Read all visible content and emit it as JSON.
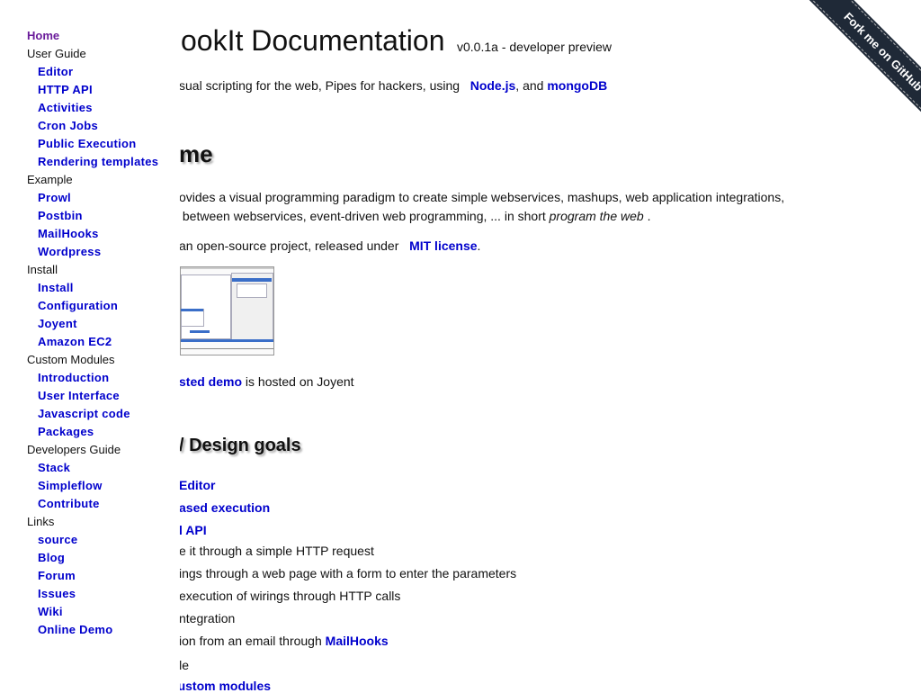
{
  "header": {
    "title": "ookIt Documentation",
    "version": "v0.0.1a - developer preview",
    "tagline_prefix": "sual scripting for the web, Pipes for hackers, using",
    "link_node": "Node.js",
    "tagline_mid": ", and",
    "link_mongo": "mongoDB"
  },
  "welcome": {
    "heading": "me",
    "p1_line1": "ovides a visual programming paradigm to create simple webservices, mashups, web application integrations,",
    "p1_line2_prefix": "between webservices, event-driven web programming, ... in short",
    "p1_italic": "program the web",
    "p1_end": ".",
    "p2_prefix": "an open-source project, released under",
    "p2_link": "MIT license",
    "p2_end": ".",
    "demo_link": "sted demo",
    "demo_suffix": "is hosted on Joyent"
  },
  "design": {
    "heading": "/ Design goals",
    "link_editor": "Editor",
    "link_exec": "ased execution",
    "link_api": "l API",
    "line_http": "e it through a simple HTTP request",
    "line_form": "ings through a web page with a form to enter the parameters",
    "line_calls": "execution of wirings through HTTP calls",
    "line_integration": "ntegration",
    "line_email_prefix": "ion from an email through",
    "link_mailhooks": "MailHooks",
    "extensible": "extensible",
    "link_custom": "add custom modules"
  },
  "sidebar": {
    "items": [
      {
        "label": "Home",
        "level": "top",
        "link": true
      },
      {
        "label": "User Guide",
        "level": "top",
        "link": false
      },
      {
        "label": "Editor",
        "level": "sub",
        "link": true
      },
      {
        "label": "HTTP API",
        "level": "sub",
        "link": true
      },
      {
        "label": "Activities",
        "level": "sub",
        "link": true
      },
      {
        "label": "Cron Jobs",
        "level": "sub",
        "link": true
      },
      {
        "label": "Public Execution",
        "level": "sub",
        "link": true
      },
      {
        "label": "Rendering templates",
        "level": "sub",
        "link": true
      },
      {
        "label": "Example",
        "level": "top",
        "link": false
      },
      {
        "label": "Prowl",
        "level": "sub",
        "link": true
      },
      {
        "label": "Postbin",
        "level": "sub",
        "link": true
      },
      {
        "label": "MailHooks",
        "level": "sub",
        "link": true
      },
      {
        "label": "Wordpress",
        "level": "sub",
        "link": true
      },
      {
        "label": "Install",
        "level": "top",
        "link": false
      },
      {
        "label": "Install",
        "level": "sub",
        "link": true
      },
      {
        "label": "Configuration",
        "level": "sub",
        "link": true
      },
      {
        "label": "Joyent",
        "level": "sub",
        "link": true
      },
      {
        "label": "Amazon EC2",
        "level": "sub",
        "link": true
      },
      {
        "label": "Custom Modules",
        "level": "top",
        "link": false
      },
      {
        "label": "Introduction",
        "level": "sub",
        "link": true
      },
      {
        "label": "User Interface",
        "level": "sub",
        "link": true
      },
      {
        "label": "Javascript code",
        "level": "sub",
        "link": true
      },
      {
        "label": "Packages",
        "level": "sub",
        "link": true
      },
      {
        "label": "Developers Guide",
        "level": "top",
        "link": false
      },
      {
        "label": "Stack",
        "level": "sub",
        "link": true
      },
      {
        "label": "Simpleflow",
        "level": "sub",
        "link": true
      },
      {
        "label": "Contribute",
        "level": "sub",
        "link": true
      },
      {
        "label": "Links",
        "level": "top",
        "link": false
      },
      {
        "label": "source",
        "level": "sub",
        "link": true
      },
      {
        "label": "Blog",
        "level": "sub",
        "link": true
      },
      {
        "label": "Forum",
        "level": "sub",
        "link": true
      },
      {
        "label": "Issues",
        "level": "sub",
        "link": true
      },
      {
        "label": "Wiki",
        "level": "sub",
        "link": true
      },
      {
        "label": "Online Demo",
        "level": "sub",
        "link": true
      }
    ]
  },
  "ribbon": {
    "label": "Fork me on GitHub"
  },
  "colors": {
    "link": "#0000cc",
    "home_link": "#6a1b9a",
    "ribbon": "#1f2937"
  }
}
